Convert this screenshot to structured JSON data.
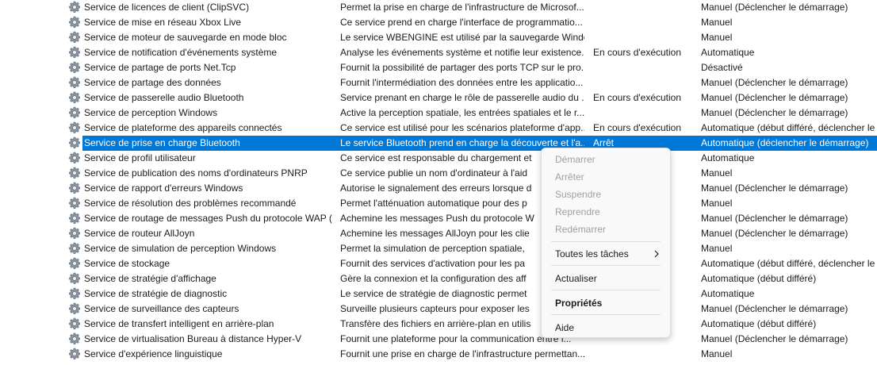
{
  "rows": [
    {
      "name": "Service de licences de client (ClipSVC)",
      "description": "Permet la prise en charge de l'infrastructure de Microsof...",
      "state": "",
      "startup": "Manuel (Déclencher le démarrage)"
    },
    {
      "name": "Service de mise en réseau Xbox Live",
      "description": "Ce service prend en charge l'interface de programmatio...",
      "state": "",
      "startup": "Manuel"
    },
    {
      "name": "Service de moteur de sauvegarde en mode bloc",
      "description": "Le service WBENGINE est utilisé par la sauvegarde Windo...",
      "state": "",
      "startup": "Manuel"
    },
    {
      "name": "Service de notification d'événements système",
      "description": "Analyse les événements système et notifie leur existence...",
      "state": "En cours d'exécution",
      "startup": "Automatique"
    },
    {
      "name": "Service de partage de ports Net.Tcp",
      "description": "Fournit la possibilité de partager des ports TCP sur le pro...",
      "state": "",
      "startup": "Désactivé"
    },
    {
      "name": "Service de partage des données",
      "description": "Fournit l'intermédiation des données entre les applicatio...",
      "state": "",
      "startup": "Manuel (Déclencher le démarrage)"
    },
    {
      "name": "Service de passerelle audio Bluetooth",
      "description": "Service prenant en charge le rôle de passerelle audio du ...",
      "state": "En cours d'exécution",
      "startup": "Manuel (Déclencher le démarrage)"
    },
    {
      "name": "Service de perception Windows",
      "description": "Active la perception spatiale, les entrées spatiales et le r...",
      "state": "",
      "startup": "Manuel (Déclencher le démarrage)"
    },
    {
      "name": "Service de plateforme des appareils connectés",
      "description": "Ce service est utilisé pour les scénarios plateforme d'app...",
      "state": "En cours d'exécution",
      "startup": "Automatique (début différé, déclencher le"
    },
    {
      "name": "Service de prise en charge Bluetooth",
      "description": "Le service Bluetooth prend en charge la découverte et l'a...",
      "state": "Arrêt",
      "startup": "Automatique (déclencher le démarrage)",
      "selected": true
    },
    {
      "name": "Service de profil utilisateur",
      "description": "Ce service est responsable du chargement et",
      "state": "",
      "startup": "Automatique"
    },
    {
      "name": "Service de publication des noms d'ordinateurs PNRP",
      "description": "Ce service publie un nom d'ordinateur à l'aid",
      "state": "",
      "startup": "Manuel"
    },
    {
      "name": "Service de rapport d'erreurs Windows",
      "description": "Autorise le signalement des erreurs lorsque d",
      "state": "",
      "startup": "Manuel (Déclencher le démarrage)"
    },
    {
      "name": "Service de résolution des problèmes recommandé",
      "description": "Permet l'atténuation automatique pour des p",
      "state": "",
      "startup": "Manuel"
    },
    {
      "name": "Service de routage de messages Push du protocole WAP (...",
      "description": "Achemine les messages Push du protocole W",
      "state": "",
      "startup": "Manuel (Déclencher le démarrage)"
    },
    {
      "name": "Service de routeur AllJoyn",
      "description": "Achemine les messages AllJoyn pour les clie",
      "state": "",
      "startup": "Manuel (Déclencher le démarrage)"
    },
    {
      "name": "Service de simulation de perception Windows",
      "description": "Permet la simulation de perception spatiale,",
      "state": "",
      "startup": "Manuel"
    },
    {
      "name": "Service de stockage",
      "description": "Fournit des services d'activation pour les pa",
      "state": "",
      "startup": "Automatique (début différé, déclencher le"
    },
    {
      "name": "Service de stratégie d'affichage",
      "description": "Gère la connexion et la configuration des aff",
      "state": "",
      "startup": "Automatique (début différé)"
    },
    {
      "name": "Service de stratégie de diagnostic",
      "description": "Le service de stratégie de diagnostic permet",
      "state": "",
      "startup": "Automatique"
    },
    {
      "name": "Service de surveillance des capteurs",
      "description": "Surveille plusieurs capteurs pour exposer les",
      "state": "",
      "startup": "Manuel (Déclencher le démarrage)"
    },
    {
      "name": "Service de transfert intelligent en arrière-plan",
      "description": "Transfère des fichiers en arrière-plan en utilis",
      "state": "",
      "startup": "Automatique (début différé)"
    },
    {
      "name": "Service de virtualisation Bureau à distance Hyper-V",
      "description": "Fournit une plateforme pour la communication entre l...",
      "state": "",
      "startup": "Manuel (Déclencher le démarrage)"
    },
    {
      "name": "Service d'expérience linguistique",
      "description": "Fournit une prise en charge de l'infrastructure permettan...",
      "state": "",
      "startup": "Manuel"
    }
  ],
  "context_menu": {
    "start": "Démarrer",
    "stop": "Arrêter",
    "pause": "Suspendre",
    "resume": "Reprendre",
    "restart": "Redémarrer",
    "all_tasks": "Toutes les tâches",
    "refresh": "Actualiser",
    "properties": "Propriétés",
    "help": "Aide"
  },
  "colors": {
    "selection": "#0078d7",
    "disabled_text": "#a0a0a0"
  },
  "icons": {
    "service": "gear-icon",
    "submenu": "chevron-right-icon"
  }
}
